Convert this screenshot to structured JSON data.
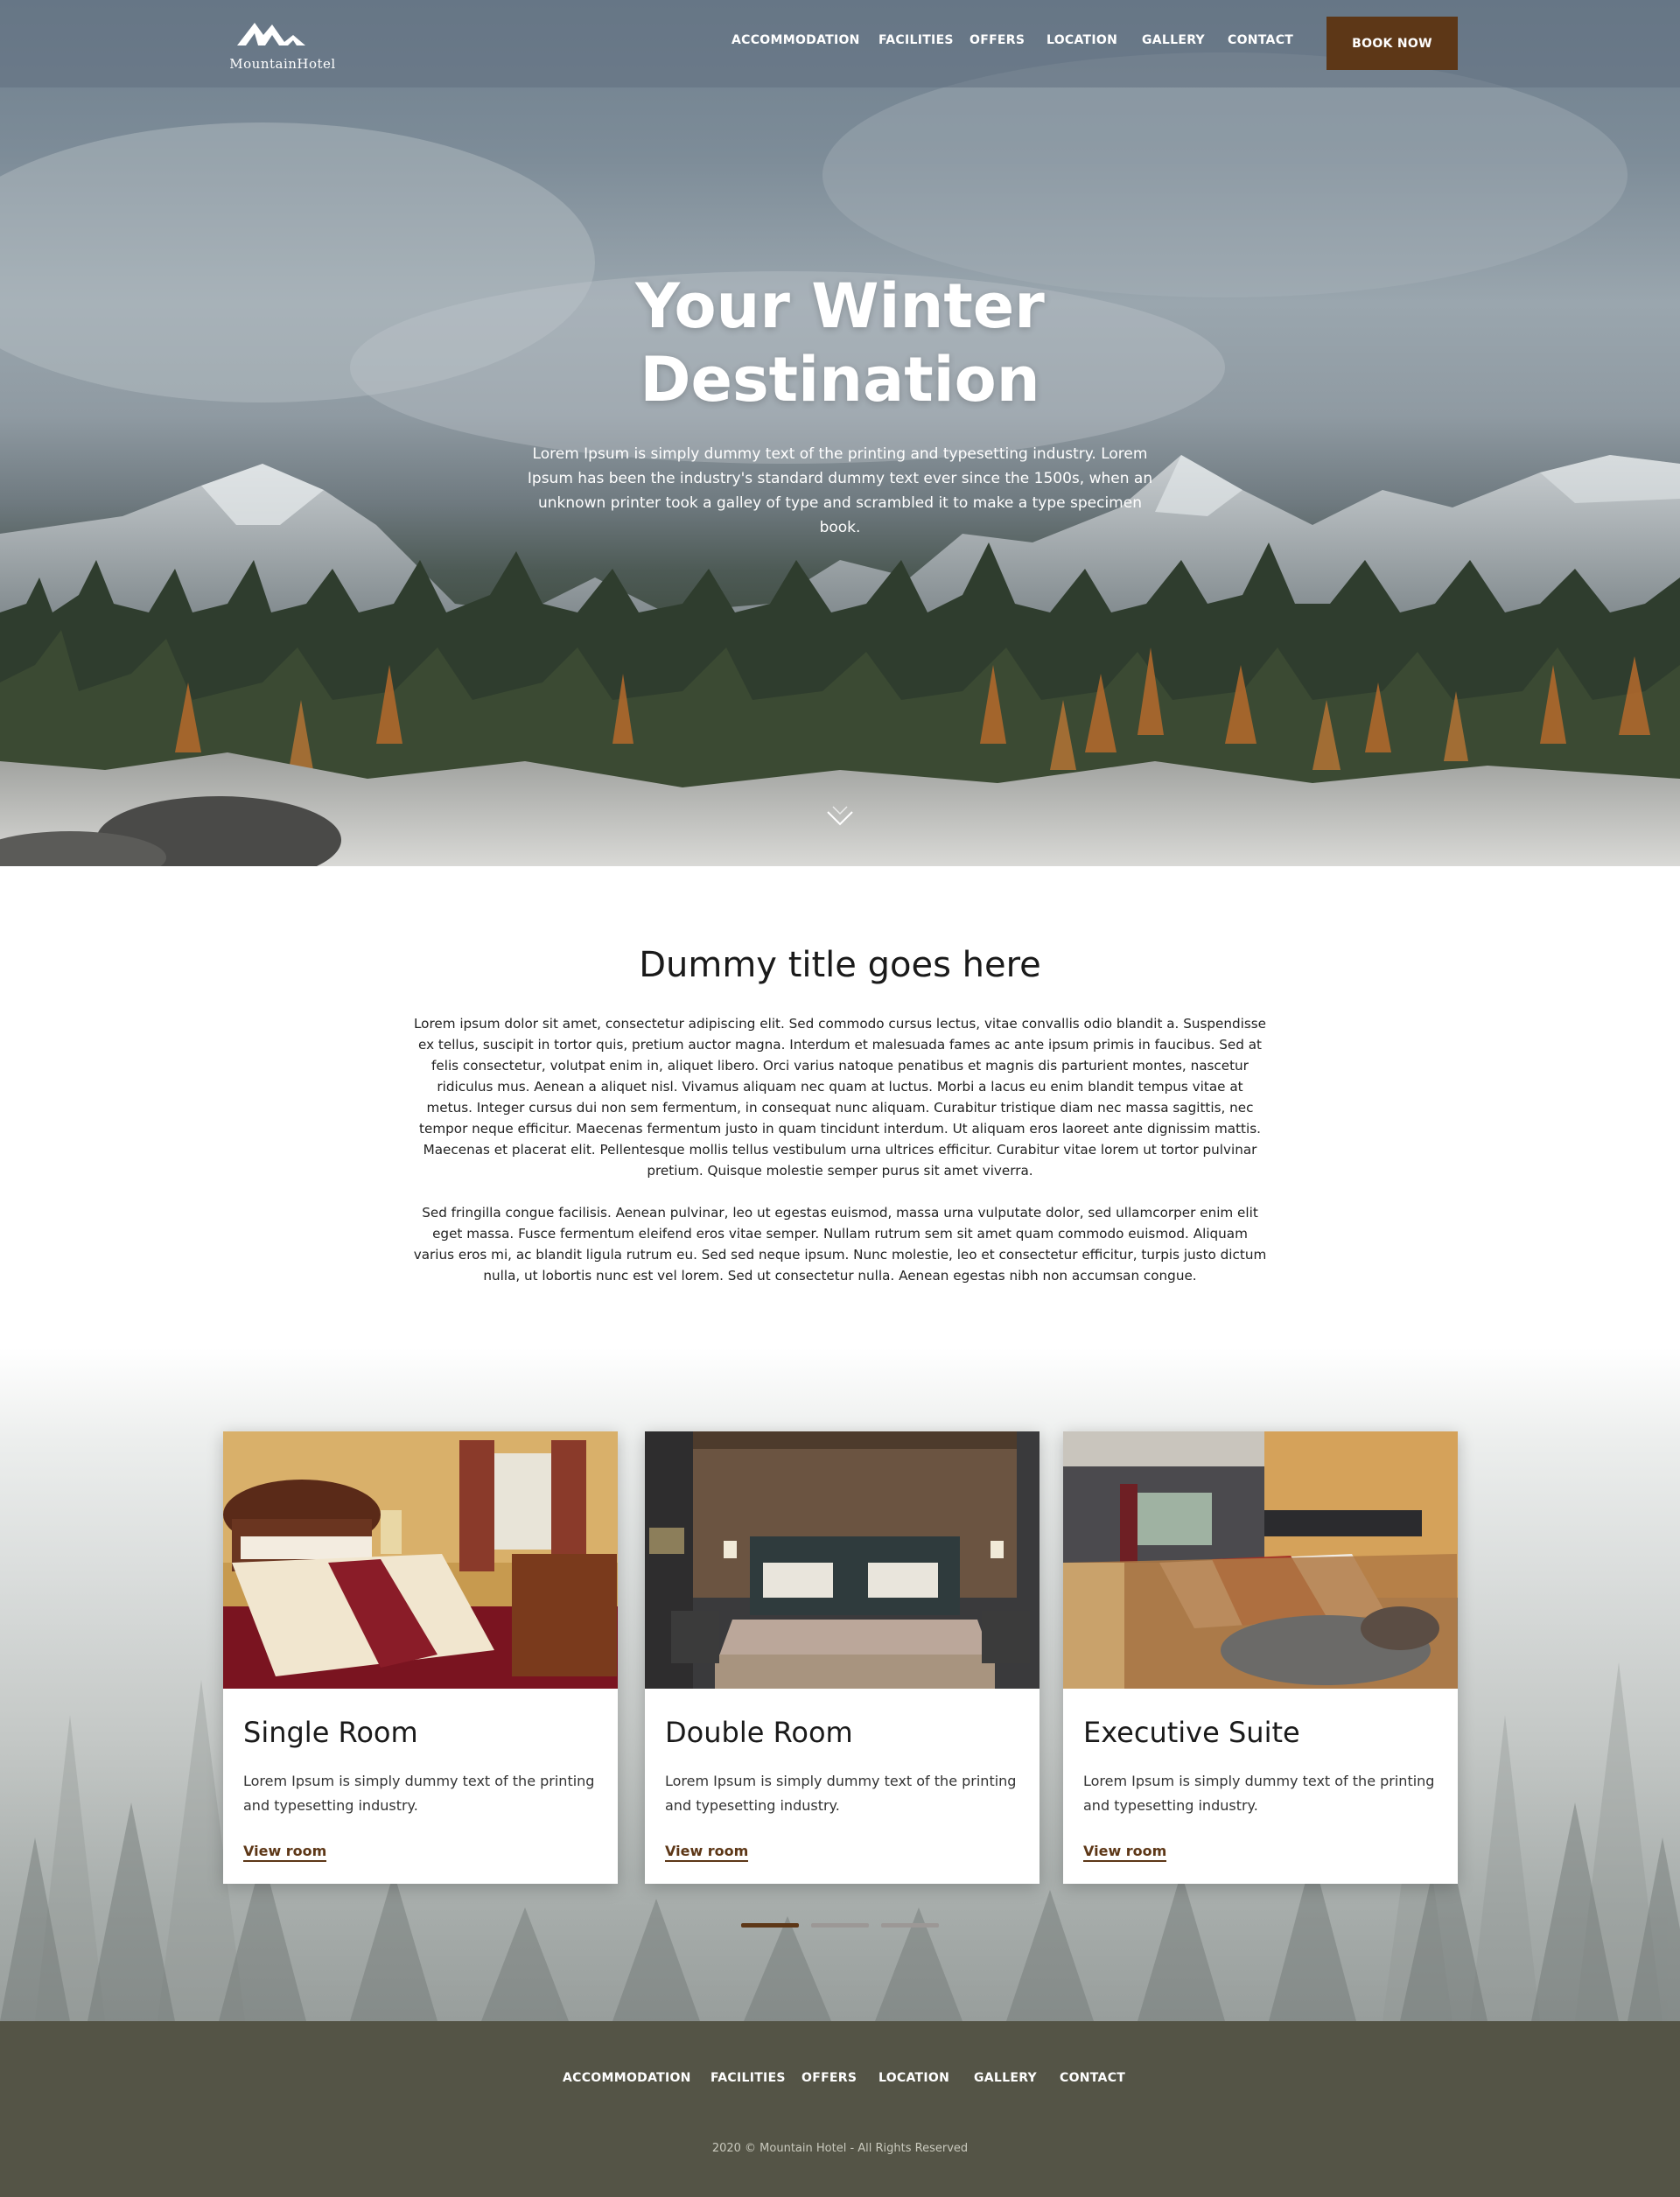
{
  "brand": {
    "name": "MountainHotel"
  },
  "header": {
    "nav": [
      "ACCOMMODATION",
      "FACILITIES",
      "OFFERS",
      "LOCATION",
      "GALLERY",
      "CONTACT"
    ],
    "book_label": "BOOK NOW"
  },
  "hero": {
    "title_line1": "Your Winter",
    "title_line2": "Destination",
    "text": "Lorem Ipsum is simply dummy text of the printing and typesetting industry. Lorem Ipsum has been the industry's standard dummy text ever since the 1500s, when an unknown printer took a galley of type and scrambled it to make a type specimen book.",
    "scroll_icon": "chevron-down-icon"
  },
  "intro": {
    "title": "Dummy title goes here",
    "paragraph1": "Lorem ipsum dolor sit amet, consectetur adipiscing elit. Sed commodo cursus lectus, vitae convallis odio blandit a. Suspendisse ex tellus, suscipit in tortor quis, pretium auctor magna. Interdum et malesuada fames ac ante ipsum primis in faucibus. Sed at felis consectetur, volutpat enim in, aliquet libero. Orci varius natoque penatibus et magnis dis parturient montes, nascetur ridiculus mus. Aenean a aliquet nisl. Vivamus aliquam nec quam at luctus. Morbi a lacus eu enim blandit tempus vitae at metus. Integer cursus dui non sem fermentum, in consequat nunc aliquam. Curabitur tristique diam nec massa sagittis, nec tempor neque efficitur. Maecenas fermentum justo in quam tincidunt interdum. Ut aliquam eros laoreet ante dignissim mattis. Maecenas et placerat elit. Pellentesque mollis tellus vestibulum urna ultrices efficitur. Curabitur vitae lorem ut tortor pulvinar pretium. Quisque molestie semper purus sit amet viverra.",
    "paragraph2": "Sed fringilla congue facilisis. Aenean pulvinar, leo ut egestas euismod, massa urna vulputate dolor, sed ullamcorper enim elit eget massa. Fusce fermentum eleifend eros vitae semper. Nullam rutrum sem sit amet quam commodo euismod. Aliquam varius eros mi, ac blandit ligula rutrum eu. Sed sed neque ipsum. Nunc molestie, leo et consectetur efficitur, turpis justo dictum nulla, ut lobortis nunc est vel lorem. Sed ut consectetur nulla. Aenean egestas nibh non accumsan congue."
  },
  "rooms": [
    {
      "title": "Single Room",
      "desc": "Lorem Ipsum is simply dummy text of the printing and typesetting industry.",
      "link": "View room"
    },
    {
      "title": "Double Room",
      "desc": "Lorem Ipsum is simply dummy text of the printing and typesetting industry.",
      "link": "View room"
    },
    {
      "title": "Executive Suite",
      "desc": "Lorem Ipsum is simply dummy text of the printing and typesetting industry.",
      "link": "View room"
    }
  ],
  "slider": {
    "count": 3,
    "active": 1
  },
  "footer": {
    "nav": [
      "ACCOMMODATION",
      "FACILITIES",
      "OFFERS",
      "LOCATION",
      "GALLERY",
      "CONTACT"
    ],
    "copyright": "2020 © Mountain Hotel - All Rights Reserved"
  },
  "colors": {
    "accent": "#5d3717",
    "footer_bg": "#545446",
    "header_overlay": "#607080"
  }
}
